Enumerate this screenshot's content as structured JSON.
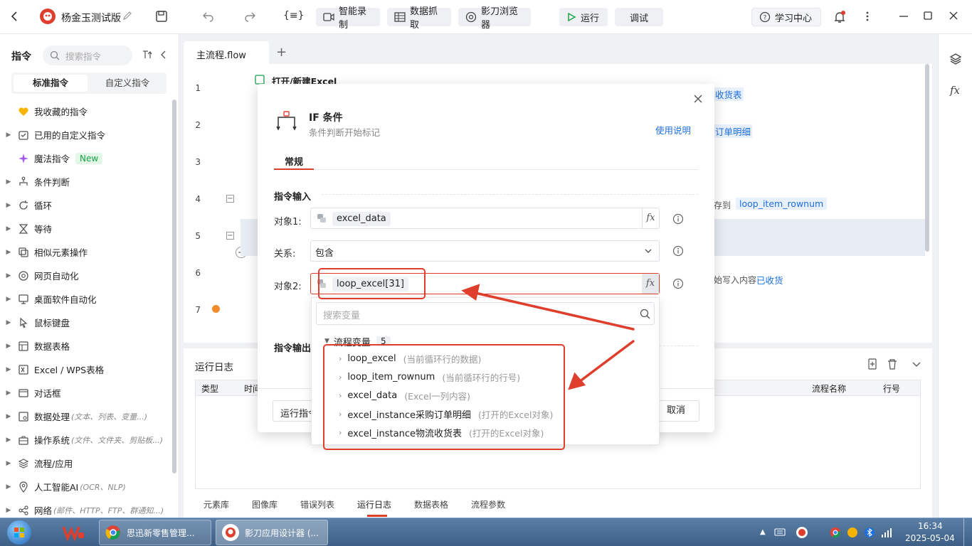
{
  "titlebar": {
    "app_title": "杨金玉测试版",
    "var_btn": "{≡}",
    "record_btn": "智能录制",
    "capture_btn": "数据抓取",
    "browser_btn": "影刀浏览器",
    "run_btn": "运行",
    "debug_btn": "调试",
    "learning_btn": "学习中心"
  },
  "sidebar": {
    "heading": "指令",
    "search_placeholder": "搜索指令",
    "tabs": [
      "标准指令",
      "自定义指令"
    ],
    "items": [
      {
        "label": "我收藏的指令",
        "hint": ""
      },
      {
        "label": "已用的自定义指令",
        "hint": ""
      },
      {
        "label": "魔法指令",
        "hint": "",
        "badge": "New"
      },
      {
        "label": "条件判断",
        "hint": ""
      },
      {
        "label": "循环",
        "hint": ""
      },
      {
        "label": "等待",
        "hint": ""
      },
      {
        "label": "相似元素操作",
        "hint": ""
      },
      {
        "label": "网页自动化",
        "hint": ""
      },
      {
        "label": "桌面软件自动化",
        "hint": ""
      },
      {
        "label": "鼠标键盘",
        "hint": ""
      },
      {
        "label": "数据表格",
        "hint": ""
      },
      {
        "label": "Excel / WPS表格",
        "hint": ""
      },
      {
        "label": "对话框",
        "hint": ""
      },
      {
        "label": "数据处理",
        "hint": "(文本、列表、变量...)"
      },
      {
        "label": "操作系统",
        "hint": "(文件、文件夹、剪贴板...)"
      },
      {
        "label": "流程/应用",
        "hint": ""
      },
      {
        "label": "人工智能AI",
        "hint": "(OCR、NLP)"
      },
      {
        "label": "网络",
        "hint": "(邮件、HTTP、FTP、群通知...)"
      }
    ]
  },
  "editor": {
    "tab_label": "主流程.flow",
    "add_tab": "+",
    "line_numbers": [
      "1",
      "2",
      "3",
      "4",
      "5",
      "6",
      "7"
    ],
    "line1_title": "打开/新建Excel",
    "right_snippets": {
      "l1": "收货表",
      "l2": "订单明细",
      "l4_pre": "存到",
      "l4_var": "loop_item_rownum",
      "l6_pre": "始写入内容",
      "l6_var": "已收货"
    }
  },
  "dialog": {
    "title": "IF 条件",
    "subtitle": "条件判断开始标记",
    "help_link": "使用说明",
    "tab": "常规",
    "section_input": "指令输入",
    "section_output": "指令输出",
    "obj1_label": "对象1:",
    "obj1_value": "excel_data",
    "relation_label": "关系:",
    "relation_value": "包含",
    "obj2_label": "对象2:",
    "obj2_value": "loop_excel[31]",
    "fx": "fx",
    "run_btn": "运行指令",
    "cancel_btn": "取消"
  },
  "dropdown": {
    "search_placeholder": "搜索变量",
    "group_label": "流程变量",
    "group_count": "5",
    "vars": [
      {
        "name": "loop_excel",
        "desc": "(当前循环行的数据)"
      },
      {
        "name": "loop_item_rownum",
        "desc": "(当前循环行的行号)"
      },
      {
        "name": "excel_data",
        "desc": "(Excel一列内容)"
      },
      {
        "name": "excel_instance采购订单明细",
        "desc": "(打开的Excel对象)"
      },
      {
        "name": "excel_instance物流收货表",
        "desc": "(打开的Excel对象)"
      }
    ]
  },
  "logs": {
    "title": "运行日志",
    "columns": {
      "type": "类型",
      "time": "时间",
      "flow_name": "流程名称",
      "line_no": "行号"
    },
    "bottom_tabs": [
      "元素库",
      "图像库",
      "错误列表",
      "运行日志",
      "数据表格",
      "流程参数"
    ]
  },
  "taskbar": {
    "tasks": [
      "思迅新零售管理...",
      "影刀应用设计器 (..."
    ],
    "clock_time": "16:34",
    "clock_date": "2025-05-04"
  },
  "colors": {
    "accent": "#1d6fe0",
    "annotation": "#e03e2d",
    "link": "#1d6fe0"
  }
}
